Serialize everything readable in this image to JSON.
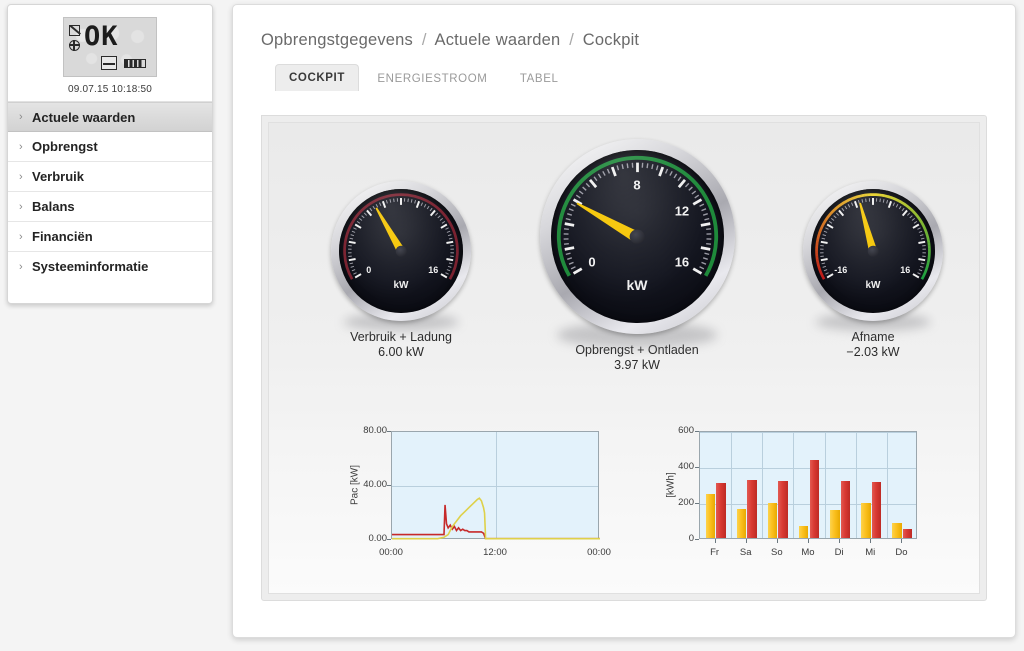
{
  "sidebar": {
    "device": {
      "lcd_text": "OK",
      "icons": [
        "sun-icon",
        "globe-icon",
        "card-icon",
        "battery-icon"
      ],
      "timestamp": "09.07.15 10:18:50"
    },
    "items": [
      {
        "label": "Actuele waarden",
        "active": true
      },
      {
        "label": "Opbrengst",
        "active": false
      },
      {
        "label": "Verbruik",
        "active": false
      },
      {
        "label": "Balans",
        "active": false
      },
      {
        "label": "Financiën",
        "active": false
      },
      {
        "label": "Systeeminformatie",
        "active": false
      }
    ],
    "arrow_glyph": "›"
  },
  "breadcrumb": {
    "root": "Opbrengstgegevens",
    "section": "Actuele waarden",
    "page": "Cockpit",
    "separator": "/"
  },
  "tabs": [
    {
      "label": "COCKPIT",
      "active": true
    },
    {
      "label": "ENERGIESTROOM",
      "active": false
    },
    {
      "label": "TABEL",
      "active": false
    }
  ],
  "gauges": [
    {
      "id": "consumption",
      "caption": "Verbruik + Ladung",
      "value_text": "6.00 kW",
      "value": 6.0,
      "unit": "kW",
      "min": 0,
      "max": 16,
      "arc_color": "#7a2230",
      "ticks": [
        {
          "label": "0",
          "value": 0
        },
        {
          "label": "16",
          "value": 16
        }
      ]
    },
    {
      "id": "production",
      "caption": "Opbrengst + Ontladen",
      "value_text": "3.97 kW",
      "value": 3.97,
      "unit": "kW",
      "min": 0,
      "max": 16,
      "arc_color": "#1f8a3b",
      "ticks": [
        {
          "label": "0",
          "value": 0
        },
        {
          "label": "8",
          "value": 8
        },
        {
          "label": "12",
          "value": 12
        },
        {
          "label": "16",
          "value": 16
        }
      ]
    },
    {
      "id": "grid-draw",
      "caption": "Afname",
      "value_text": "−2.03 kW",
      "value": -2.03,
      "unit": "kW",
      "min": -16,
      "max": 16,
      "arc_color": "gradient-red-yellow-green",
      "ticks": [
        {
          "label": "-16",
          "value": -16
        },
        {
          "label": "16",
          "value": 16
        }
      ]
    }
  ],
  "chart_data": [
    {
      "type": "line",
      "id": "pac-day-chart",
      "title": "",
      "xlabel": "",
      "ylabel": "Pac [kW]",
      "ylim": [
        0,
        80
      ],
      "yticks": [
        "0.00",
        "40.00",
        "80.00"
      ],
      "ytick_values": [
        0,
        40,
        80
      ],
      "xticks": [
        "00:00",
        "12:00",
        "00:00"
      ],
      "xtick_positions": [
        0,
        0.5,
        1.0
      ],
      "grid": true,
      "legend": "none",
      "series": [
        {
          "name": "red",
          "color": "#c62a2a",
          "points": [
            [
              0.0,
              4
            ],
            [
              0.1,
              4
            ],
            [
              0.18,
              4
            ],
            [
              0.22,
              4
            ],
            [
              0.25,
              4
            ],
            [
              0.255,
              26
            ],
            [
              0.262,
              12
            ],
            [
              0.27,
              9
            ],
            [
              0.28,
              11
            ],
            [
              0.29,
              8
            ],
            [
              0.3,
              10
            ],
            [
              0.31,
              7
            ],
            [
              0.32,
              9
            ],
            [
              0.33,
              7
            ],
            [
              0.34,
              8
            ],
            [
              0.35,
              7
            ],
            [
              0.36,
              7
            ],
            [
              0.37,
              6
            ],
            [
              0.4,
              6
            ],
            [
              0.43,
              6
            ],
            [
              0.44,
              5
            ],
            [
              0.45,
              1
            ],
            [
              0.5,
              1
            ],
            [
              0.7,
              1
            ],
            [
              1.0,
              1
            ]
          ]
        },
        {
          "name": "yellow",
          "color": "#ded14a",
          "points": [
            [
              0.0,
              1
            ],
            [
              0.15,
              1
            ],
            [
              0.22,
              1
            ],
            [
              0.25,
              2
            ],
            [
              0.27,
              4
            ],
            [
              0.29,
              10
            ],
            [
              0.31,
              14
            ],
            [
              0.33,
              18
            ],
            [
              0.35,
              21
            ],
            [
              0.37,
              24
            ],
            [
              0.39,
              27
            ],
            [
              0.41,
              30
            ],
            [
              0.42,
              31
            ],
            [
              0.43,
              29
            ],
            [
              0.44,
              24
            ],
            [
              0.445,
              20
            ],
            [
              0.45,
              1
            ],
            [
              0.6,
              1
            ],
            [
              1.0,
              1
            ]
          ]
        }
      ]
    },
    {
      "type": "bar",
      "id": "weekly-energy-chart",
      "title": "",
      "xlabel": "",
      "ylabel": "[kWh]",
      "ylim": [
        0,
        600
      ],
      "yticks": [
        "0",
        "200",
        "400",
        "600"
      ],
      "ytick_values": [
        0,
        200,
        400,
        600
      ],
      "categories": [
        "Fr",
        "Sa",
        "So",
        "Mo",
        "Di",
        "Mi",
        "Do"
      ],
      "grid": true,
      "legend": "none",
      "series": [
        {
          "name": "yellow",
          "color": "#fbc01f",
          "values": [
            243,
            163,
            196,
            68,
            155,
            192,
            83
          ]
        },
        {
          "name": "red",
          "color": "#d93a33",
          "values": [
            305,
            322,
            315,
            432,
            318,
            312,
            52
          ]
        }
      ]
    }
  ]
}
